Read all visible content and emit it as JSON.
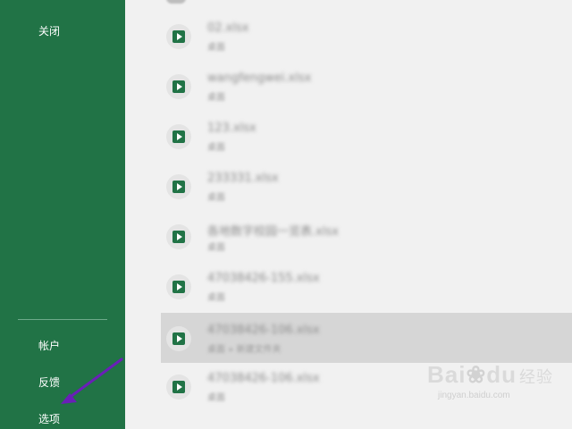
{
  "sidebar": {
    "close_label": "关闭",
    "account_label": "帐户",
    "feedback_label": "反馈",
    "options_label": "选项"
  },
  "files": [
    {
      "name": "02.xlsx",
      "sub": "桌面"
    },
    {
      "name": "wangfengwei.xlsx",
      "sub": "桌面"
    },
    {
      "name": "123.xlsx",
      "sub": "桌面"
    },
    {
      "name": "233331.xlsx",
      "sub": "桌面"
    },
    {
      "name": "各地数字校园一览表.xlsx",
      "sub": "桌面"
    },
    {
      "name": "47038426-155.xlsx",
      "sub": "桌面"
    },
    {
      "name": "47038426-106.xlsx",
      "sub": "桌面 » 新建文件夹"
    },
    {
      "name": "47038426-106.xlsx",
      "sub": "桌面"
    }
  ],
  "icons": {
    "file": "excel-file-icon",
    "annotation": "arrow-icon"
  },
  "colors": {
    "sidebar_bg": "#217346",
    "annotation_arrow": "#6a1fb8",
    "selected_row": "#d6d6d6"
  },
  "watermark": {
    "logo_text": "Bai",
    "logo_text2": "du",
    "logo_cn": "经验",
    "url": "jingyan.baidu.com"
  }
}
